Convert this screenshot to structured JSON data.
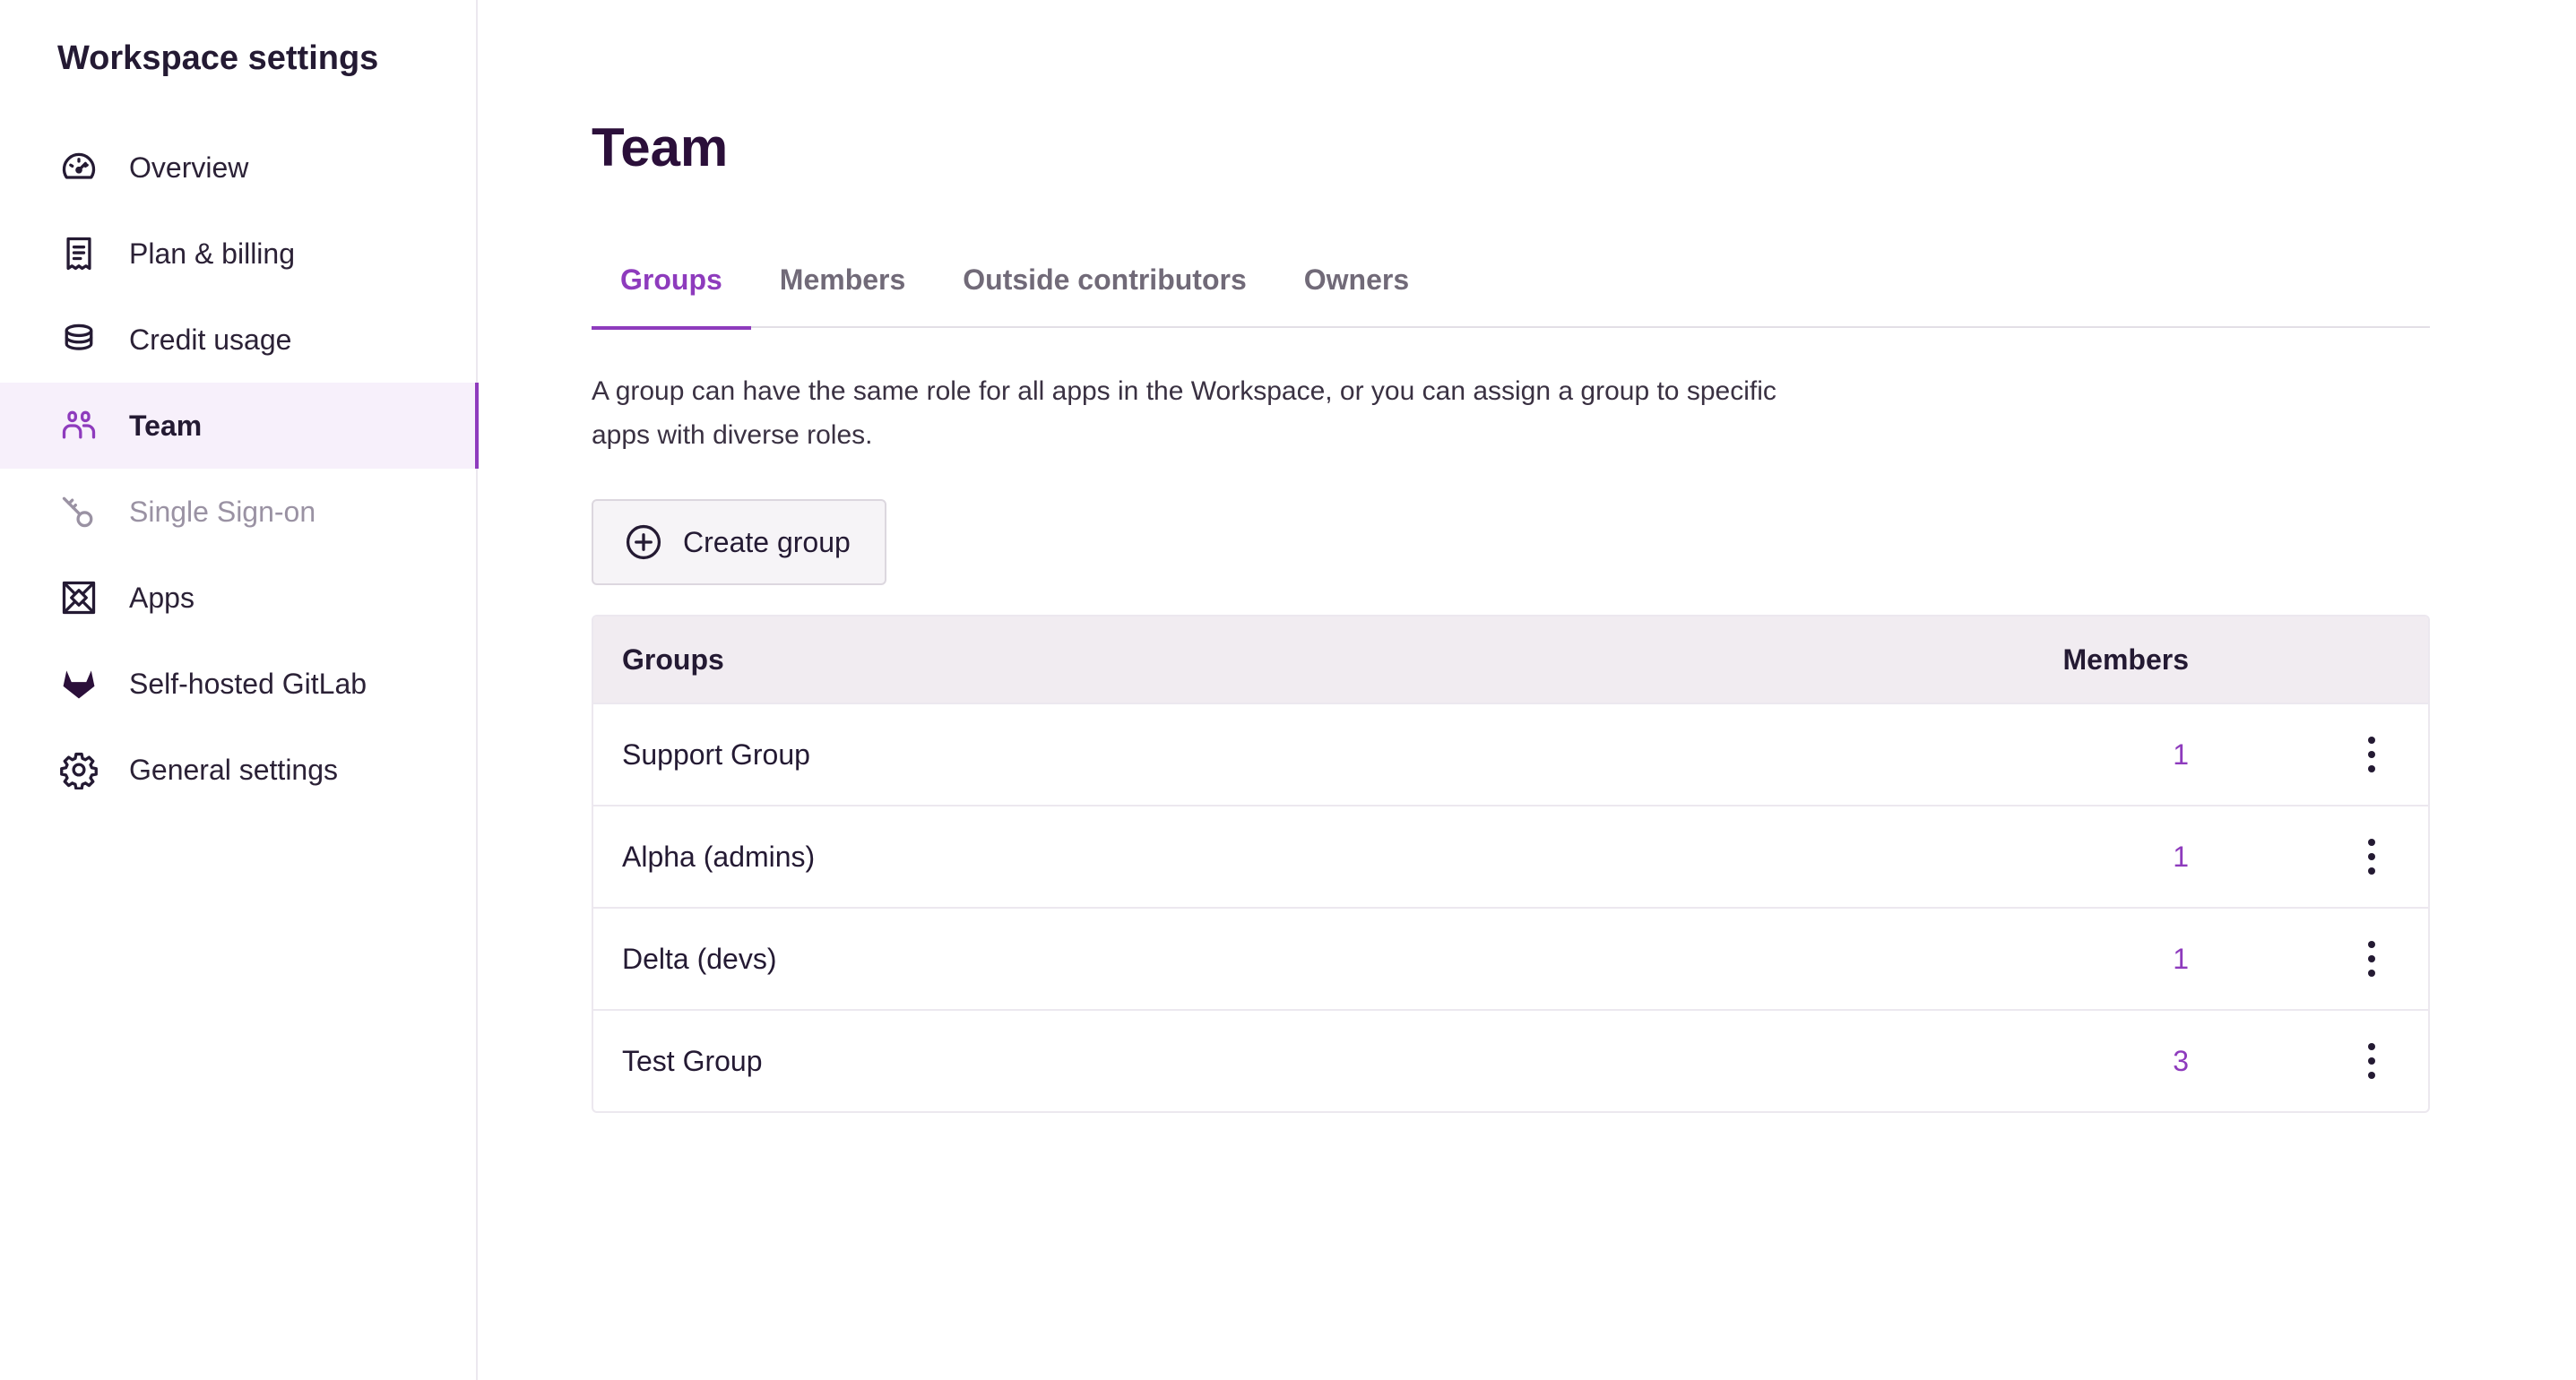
{
  "sidebar": {
    "title": "Workspace settings",
    "items": [
      {
        "label": "Overview",
        "icon": "speedometer-icon"
      },
      {
        "label": "Plan & billing",
        "icon": "receipt-icon"
      },
      {
        "label": "Credit usage",
        "icon": "coin-stack-icon"
      },
      {
        "label": "Team",
        "icon": "team-icon",
        "active": true
      },
      {
        "label": "Single Sign-on",
        "icon": "key-icon",
        "disabled": true
      },
      {
        "label": "Apps",
        "icon": "apps-box-icon"
      },
      {
        "label": "Self-hosted GitLab",
        "icon": "gitlab-icon"
      },
      {
        "label": "General settings",
        "icon": "gear-icon"
      }
    ]
  },
  "main": {
    "title": "Team",
    "tabs": [
      {
        "label": "Groups",
        "active": true
      },
      {
        "label": "Members"
      },
      {
        "label": "Outside contributors"
      },
      {
        "label": "Owners"
      }
    ],
    "description": "A group can have the same role for all apps in the Workspace, or you can assign a group to specific apps with diverse roles.",
    "create_button": {
      "label": "Create group",
      "icon": "plus-circle-icon"
    },
    "table": {
      "headers": {
        "name": "Groups",
        "members": "Members"
      },
      "rows": [
        {
          "name": "Support Group",
          "members": "1"
        },
        {
          "name": "Alpha (admins)",
          "members": "1"
        },
        {
          "name": "Delta (devs)",
          "members": "1"
        },
        {
          "name": "Test Group",
          "members": "3"
        }
      ]
    }
  },
  "colors": {
    "accent": "#8e3bbd",
    "text": "#241a33",
    "active_bg": "#f7f0fb",
    "header_bg": "#f1ecf1"
  }
}
